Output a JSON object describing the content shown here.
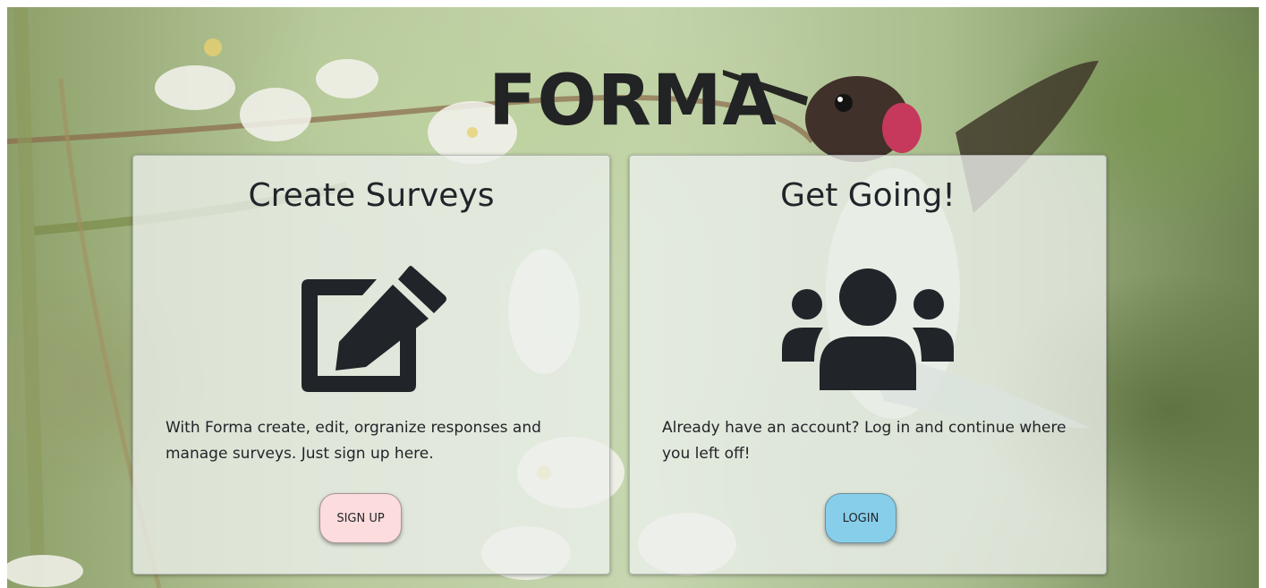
{
  "app": {
    "title": "FORMA"
  },
  "cards": {
    "create": {
      "title": "Create Surveys",
      "icon": "edit-icon",
      "description": "With Forma create, edit, orgranize responses and manage surveys. Just sign up here.",
      "button_label": "SIGN UP",
      "button_color": "#fcdcdc"
    },
    "login": {
      "title": "Get Going!",
      "icon": "users-icon",
      "description": "Already have an account? Log in and continue where you left off!",
      "button_label": "LOGIN",
      "button_color": "#87ceeb"
    }
  },
  "colors": {
    "text": "#212529",
    "card_background": "#ecf0ec"
  }
}
